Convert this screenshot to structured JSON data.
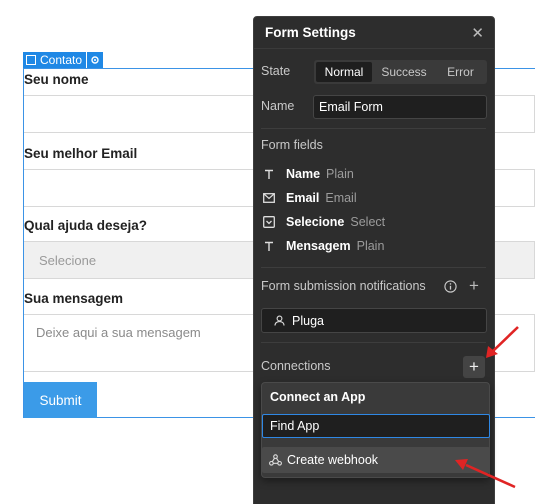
{
  "canvas": {
    "selection_tag": "Contato",
    "fields": [
      {
        "label": "Seu nome",
        "value": ""
      },
      {
        "label": "Seu melhor Email",
        "value": ""
      },
      {
        "label": "Qual ajuda deseja?",
        "placeholder": "Selecione"
      },
      {
        "label": "Sua mensagem",
        "placeholder": "Deixe aqui a sua mensagem"
      }
    ],
    "submit_label": "Submit"
  },
  "panel": {
    "title": "Form Settings",
    "close_icon": "close-icon",
    "state_label": "State",
    "states": [
      "Normal",
      "Success",
      "Error"
    ],
    "active_state": "Normal",
    "name_label": "Name",
    "name_value": "Email Form",
    "form_fields_heading": "Form fields",
    "form_fields": [
      {
        "icon": "text-icon",
        "name": "Name",
        "type": "Plain"
      },
      {
        "icon": "email-icon",
        "name": "Email",
        "type": "Email"
      },
      {
        "icon": "select-icon",
        "name": "Selecione",
        "type": "Select"
      },
      {
        "icon": "text-icon",
        "name": "Mensagem",
        "type": "Plain"
      }
    ],
    "notifications_heading": "Form submission notifications",
    "notification_recipient": "Pluga",
    "connections_heading": "Connections",
    "popover": {
      "title": "Connect an App",
      "search_value": "Find App",
      "item_label": "Create webhook"
    }
  },
  "colors": {
    "accent": "#1f88e5",
    "panel_bg": "#2d2d2d",
    "annotation_arrow": "#e02424"
  }
}
